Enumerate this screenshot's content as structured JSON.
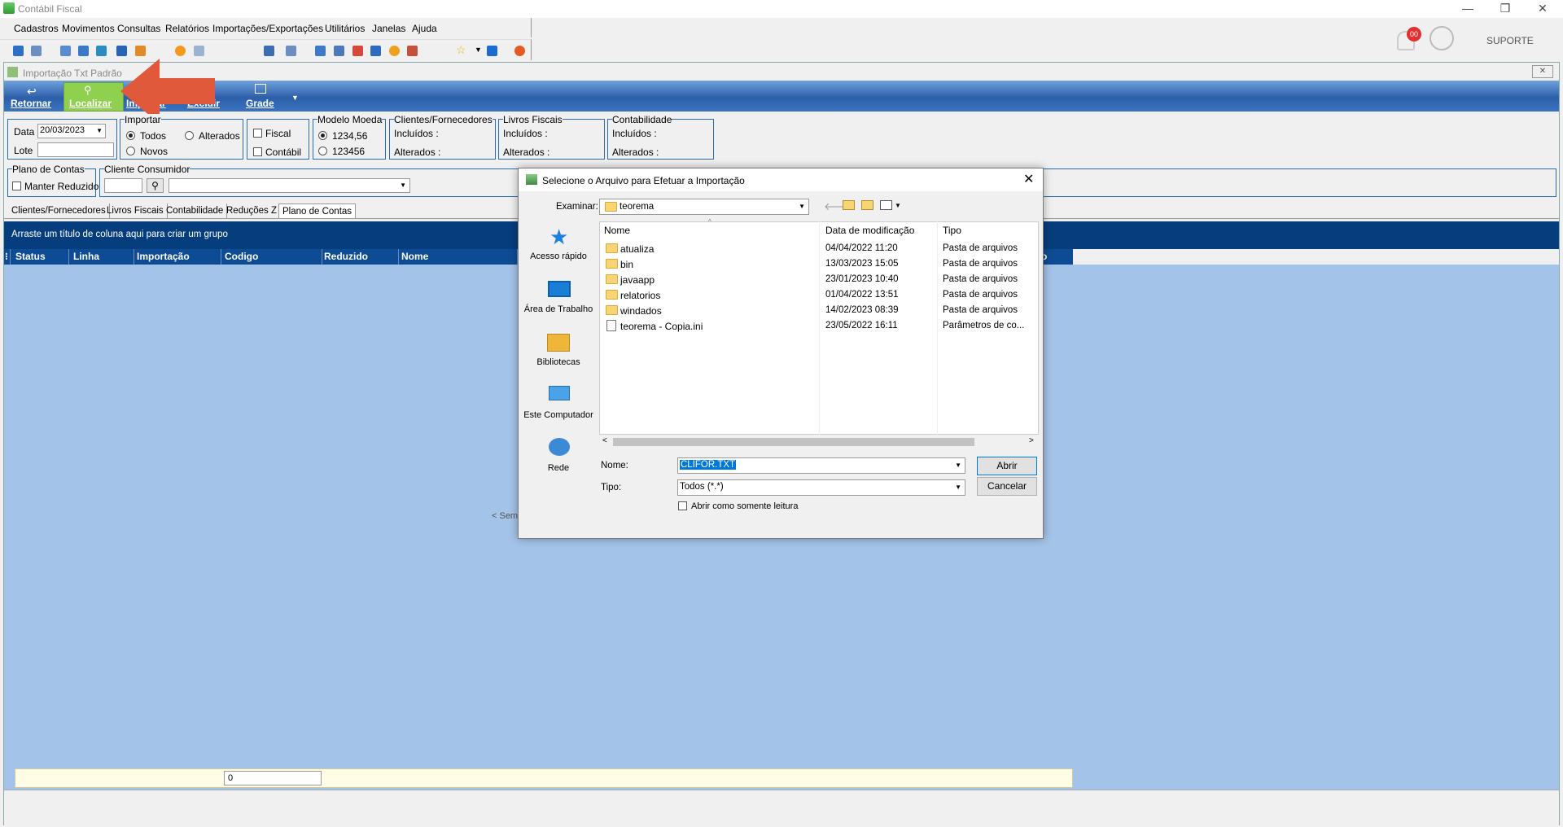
{
  "app": {
    "title": "Contábil Fiscal",
    "user": "SUPORTE",
    "notif_count": "00"
  },
  "window_controls": {
    "minimize": "—",
    "restore": "❐",
    "close": "✕"
  },
  "menu": [
    "Cadastros",
    "Movimentos",
    "Consultas",
    "Relatórios",
    "Importações/Exportações",
    "Utilitários",
    "Janelas",
    "Ajuda"
  ],
  "child": {
    "title": "Importação Txt Padrão",
    "close": "✕"
  },
  "ribbon": {
    "retornar": "Retornar",
    "localizar": "Localizar",
    "importar": "Importar",
    "excluir": "Excluir",
    "grade": "Grade"
  },
  "filters": {
    "data_label": "Data",
    "data_value": "20/03/2023",
    "lote_label": "Lote",
    "import_group": "Importar",
    "todos": "Todos",
    "alterados": "Alterados",
    "novos": "Novos",
    "fiscal": "Fiscal",
    "contabil": "Contábil",
    "moeda_group": "Modelo Moeda",
    "moeda1": "1234,56",
    "moeda2": "123456",
    "clientes_group": "Clientes/Fornecedores",
    "livros_group": "Livros Fiscais",
    "contab_group": "Contabilidade",
    "incluidos": "Incluídos :",
    "alterados_label": "Alterados :",
    "plano_group": "Plano de Contas",
    "manter": "Manter Reduzido",
    "consumidor_group": "Cliente Consumidor"
  },
  "tabs": [
    "Clientes/Fornecedores",
    "Livros Fiscais",
    "Contabilidade",
    "Reduções Z",
    "Plano de Contas"
  ],
  "grid": {
    "group_hint": "Arraste um título de coluna aqui para criar um grupo",
    "columns": [
      "Status",
      "Linha",
      "Importação",
      "Codigo",
      "Reduzido",
      "Nome"
    ],
    "last_col_fragment": "o",
    "empty": "< Sem",
    "footer_value": "0"
  },
  "dialog": {
    "title": "Selecione o Arquivo para Efetuar a Importação",
    "examinar_label": "Examinar:",
    "folder": "teorema",
    "places": [
      "Acesso rápido",
      "Área de Trabalho",
      "Bibliotecas",
      "Este Computador",
      "Rede"
    ],
    "headers": [
      "Nome",
      "Data de modificação",
      "Tipo"
    ],
    "files": [
      {
        "name": "atualiza",
        "date": "04/04/2022 11:20",
        "type": "Pasta de arquivos"
      },
      {
        "name": "bin",
        "date": "13/03/2023 15:05",
        "type": "Pasta de arquivos"
      },
      {
        "name": "javaapp",
        "date": "23/01/2023 10:40",
        "type": "Pasta de arquivos"
      },
      {
        "name": "relatorios",
        "date": "01/04/2022 13:51",
        "type": "Pasta de arquivos"
      },
      {
        "name": "windados",
        "date": "14/02/2023 08:39",
        "type": "Pasta de arquivos"
      },
      {
        "name": "teorema - Copia.ini",
        "date": "23/05/2022 16:11",
        "type": "Parâmetros de co..."
      }
    ],
    "nome_label": "Nome:",
    "nome_value": "CLIFOR.TXT",
    "tipo_label": "Tipo:",
    "tipo_value": "Todos (*.*)",
    "readonly": "Abrir como somente leitura",
    "abrir": "Abrir",
    "cancelar": "Cancelar"
  },
  "colors": {
    "accent": "#2c5fa8",
    "grid_bg": "#a4c3e8",
    "arrow": "#e0593a",
    "highlight": "#8fd14f"
  }
}
